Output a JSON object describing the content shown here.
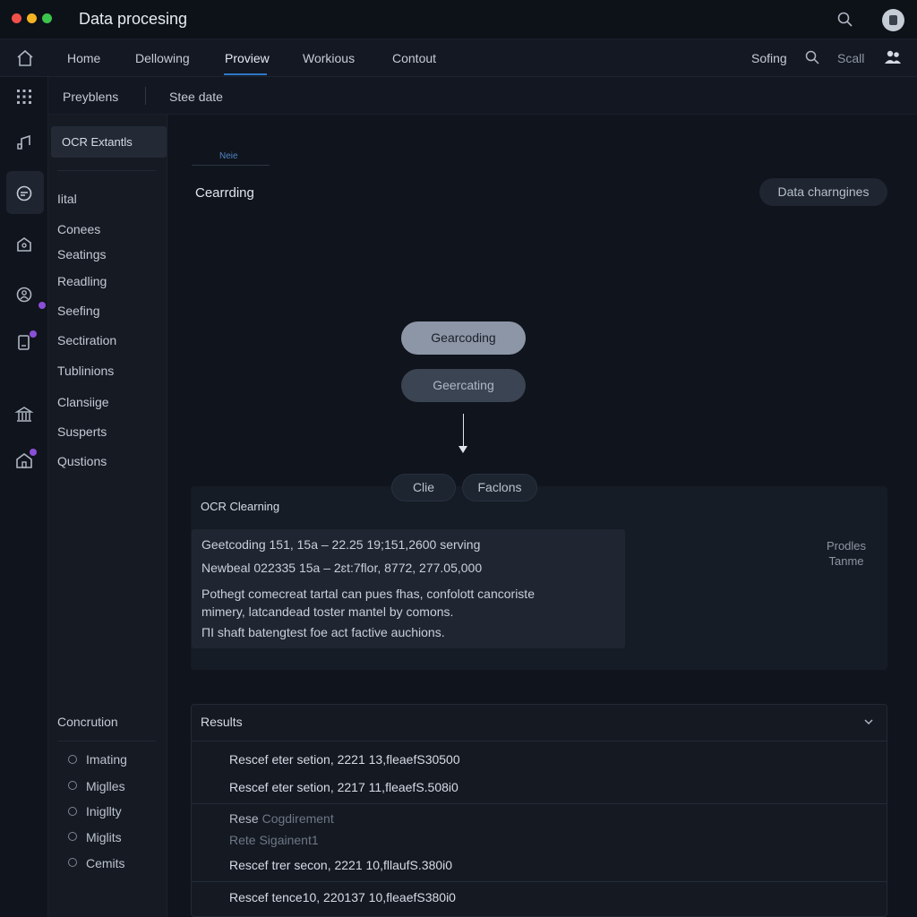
{
  "window": {
    "title": "Data procesing"
  },
  "nav": {
    "items": [
      "Home",
      "Dellowing",
      "Proview",
      "Workious",
      "Contout"
    ],
    "active_index": 2,
    "right": {
      "sofing": "Sofing",
      "scall": "Scall"
    }
  },
  "subbar": {
    "items": [
      "Preyblens",
      "Stee date"
    ]
  },
  "sidebar": {
    "selected": "OCR Extantls",
    "items": [
      "Iital",
      "Conees",
      "Seatings",
      "Readling",
      "Seefing",
      "Sectiration",
      "Tublinions",
      "Clansiige",
      "Susperts",
      "Qustions"
    ],
    "section_title": "Concrution",
    "sub_items": [
      "Imating",
      "Miglles",
      "Inigllty",
      "Miglits",
      "Cemits"
    ]
  },
  "main": {
    "crumb": "Neie",
    "title": "Cearrding",
    "action_button": "Data charngines",
    "flow": {
      "node1": "Gearcoding",
      "node2": "Geercating",
      "chip1": "Clie",
      "chip2": "Faclons"
    }
  },
  "ocr": {
    "title": "OCR Clearning",
    "lines": [
      "Geetcoding 151, 15a – 22.25 19;151,2600 serving",
      "Newbeal 022335 15a – 2ɛt:7flor, 8772, 277.05,000",
      "Pothegt comecreat tartal can pues fhas, confolott cancoriste",
      "mimery, latcandead toster mantel by comons.",
      "ΠI shaft batengtest foe act factive auchions."
    ],
    "side_note": [
      "Prodles",
      "Tanme"
    ]
  },
  "results": {
    "title": "Results",
    "rows": [
      "Rescef eter setion, 2221 13,fleaefS30500",
      "Rescef eter setion, 2217 11,fleaefS.508i0"
    ],
    "dim_rows": [
      {
        "prefix": "Rese",
        "rest": " Cogdirement"
      },
      {
        "prefix": "",
        "rest": "Rete Sigainent1"
      }
    ],
    "rows2": [
      "Rescef trer secon, 2221 10,fllaufS.380i0",
      "Rescef tence10, 220137 10,fleaefS380i0"
    ]
  },
  "colors": {
    "accent": "#2f78c8",
    "window_red": "#f0504a",
    "window_yellow": "#f4b321",
    "window_green": "#3cc54c",
    "badge": "#8a4fd6"
  },
  "icons": [
    "search-icon",
    "avatar",
    "home-icon",
    "grid-icon",
    "music-icon",
    "chat-icon",
    "shield-home-icon",
    "user-search-icon",
    "phone-icon",
    "bank-icon",
    "house-icon",
    "users-icon",
    "chevron-down-icon"
  ]
}
